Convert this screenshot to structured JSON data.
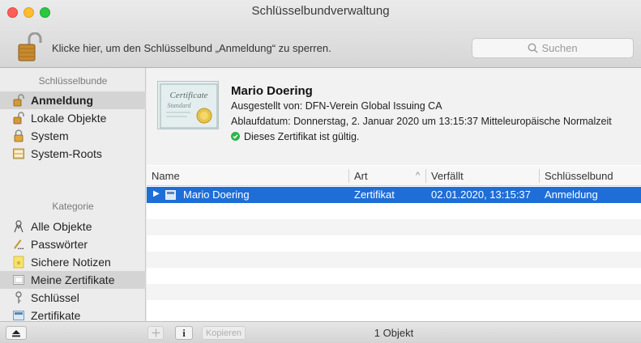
{
  "window": {
    "title": "Schlüsselbundverwaltung"
  },
  "toolbar": {
    "lock_message": "Klicke hier, um den Schlüsselbund „Anmeldung“ zu sperren.",
    "search_placeholder": "Suchen"
  },
  "sidebar": {
    "keychains_header": "Schlüsselbunde",
    "keychains": [
      {
        "label": "Anmeldung",
        "icon": "lock-open-icon"
      },
      {
        "label": "Lokale Objekte",
        "icon": "lock-open-icon"
      },
      {
        "label": "System",
        "icon": "lock-closed-icon"
      },
      {
        "label": "System-Roots",
        "icon": "cabinet-icon"
      }
    ],
    "category_header": "Kategorie",
    "categories": [
      {
        "label": "Alle Objekte",
        "icon": "people-icon"
      },
      {
        "label": "Passwörter",
        "icon": "pen-icon"
      },
      {
        "label": "Sichere Notizen",
        "icon": "note-icon"
      },
      {
        "label": "Meine Zertifikate",
        "icon": "my-certificate-icon"
      },
      {
        "label": "Schlüssel",
        "icon": "key-icon"
      },
      {
        "label": "Zertifikate",
        "icon": "certificate-icon"
      }
    ]
  },
  "certificate": {
    "thumb_line1": "Certificate",
    "thumb_line2": "Standard",
    "name": "Mario Doering",
    "issued_by": "Ausgestellt von: DFN-Verein Global Issuing CA",
    "expiry": "Ablaufdatum: Donnerstag, 2. Januar 2020 um 13:15:37 Mitteleuropäische Normalzeit",
    "validity": "Dieses Zertifikat ist gültig."
  },
  "table": {
    "headers": {
      "name": "Name",
      "kind": "Art",
      "expires": "Verfällt",
      "keychain": "Schlüsselbund"
    },
    "sort_indicator": "^",
    "rows": [
      {
        "name": "Mario Doering",
        "kind": "Zertifikat",
        "expires": "02.01.2020, 13:15:37",
        "keychain": "Anmeldung"
      }
    ]
  },
  "bottombar": {
    "info_label": "i",
    "copy_label": "Kopieren",
    "status": "1 Objekt"
  },
  "colors": {
    "selection": "#1f6ed7",
    "valid": "#2fb34a"
  }
}
